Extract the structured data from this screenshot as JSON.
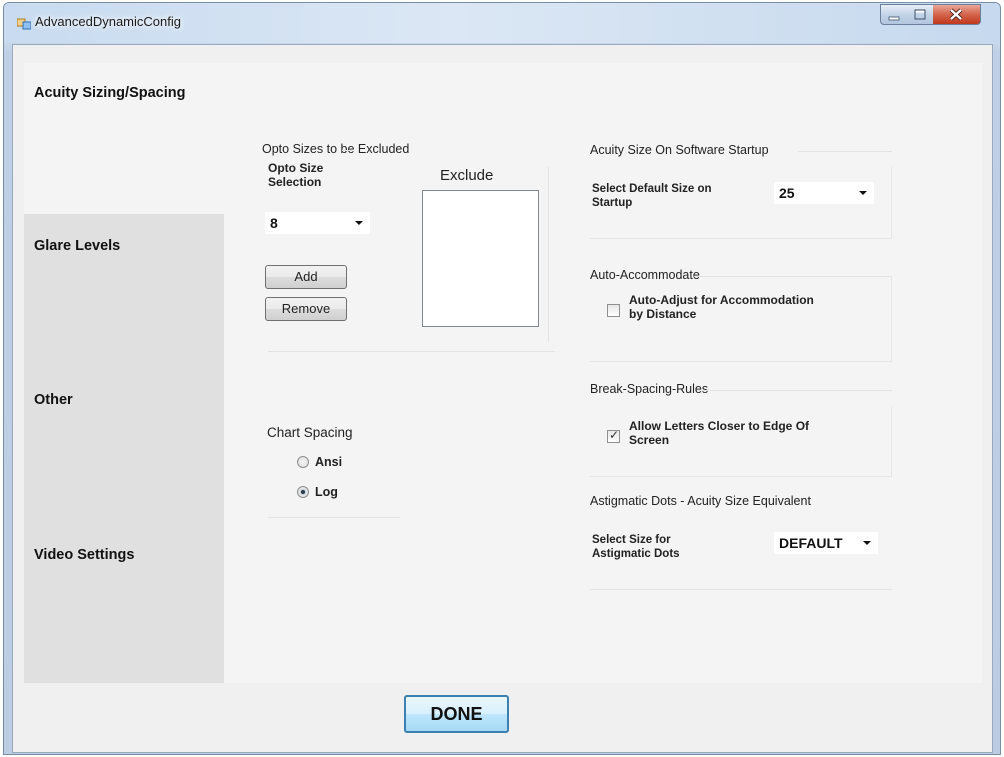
{
  "window": {
    "title": "AdvancedDynamicConfig",
    "controls": {
      "minimize_icon": "minimize-icon",
      "maximize_icon": "maximize-icon",
      "close_icon": "close-icon"
    }
  },
  "sidebar": {
    "tabs": [
      {
        "label": "Acuity Sizing/Spacing",
        "active": true
      },
      {
        "label": "Glare Levels",
        "active": false
      },
      {
        "label": "Other",
        "active": false
      },
      {
        "label": "Video Settings",
        "active": false
      }
    ]
  },
  "opto": {
    "group_label": "Opto Sizes to be Excluded",
    "selection_label": "Opto Size Selection",
    "selected_value": "8",
    "add_label": "Add",
    "remove_label": "Remove",
    "exclude_label": "Exclude",
    "exclude_items": []
  },
  "chart_spacing": {
    "label": "Chart Spacing",
    "options": [
      {
        "label": "Ansi",
        "checked": false
      },
      {
        "label": "Log",
        "checked": true
      }
    ]
  },
  "acuity_startup": {
    "group_label": "Acuity Size On Software Startup",
    "field_label": "Select Default Size on Startup",
    "value": "25"
  },
  "auto_accommodate": {
    "group_label": "Auto-Accommodate",
    "checkbox_label": "Auto-Adjust for Accommodation by Distance",
    "checked": false
  },
  "break_spacing": {
    "group_label": "Break-Spacing-Rules",
    "checkbox_label": "Allow Letters Closer to Edge Of Screen",
    "checked": true
  },
  "astigmatic": {
    "group_label": "Astigmatic Dots - Acuity Size Equivalent",
    "field_label": "Select Size for Astigmatic Dots",
    "value": "DEFAULT"
  },
  "footer": {
    "done_label": "DONE"
  }
}
